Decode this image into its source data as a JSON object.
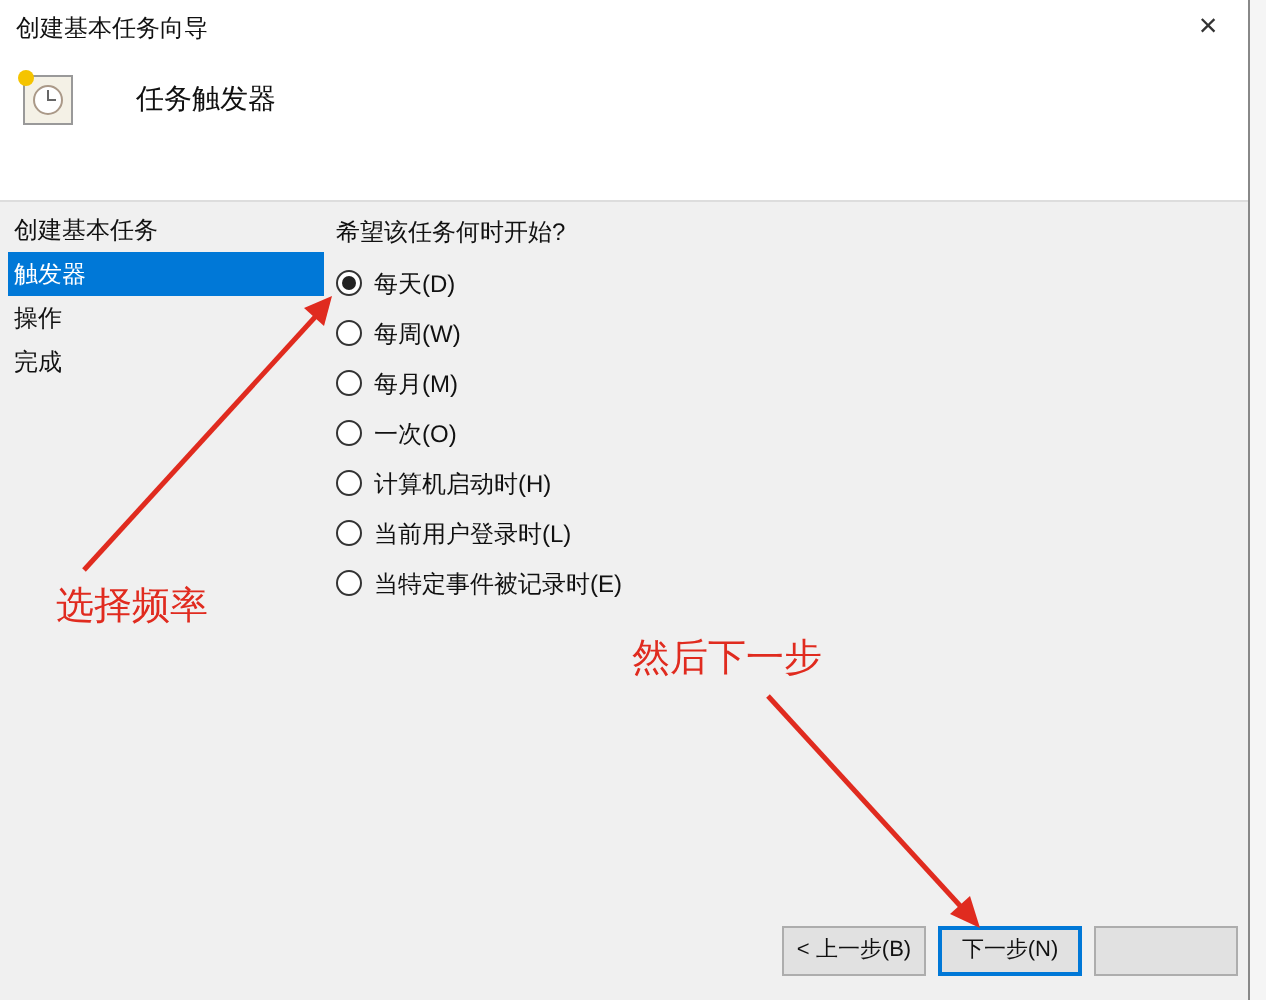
{
  "window": {
    "title": "创建基本任务向导",
    "close": "×"
  },
  "header": {
    "title": "任务触发器"
  },
  "sidebar": {
    "items": [
      {
        "label": "创建基本任务",
        "selected": false
      },
      {
        "label": "触发器",
        "selected": true
      },
      {
        "label": "操作",
        "selected": false
      },
      {
        "label": "完成",
        "selected": false
      }
    ]
  },
  "question": "希望该任务何时开始?",
  "options": [
    {
      "label": "每天(D)",
      "selected": true
    },
    {
      "label": "每周(W)",
      "selected": false
    },
    {
      "label": "每月(M)",
      "selected": false
    },
    {
      "label": "一次(O)",
      "selected": false
    },
    {
      "label": "计算机启动时(H)",
      "selected": false
    },
    {
      "label": "当前用户登录时(L)",
      "selected": false
    },
    {
      "label": "当特定事件被记录时(E)",
      "selected": false
    }
  ],
  "buttons": [
    {
      "label": "< 上一步(B)",
      "focused": false
    },
    {
      "label": "下一步(N)",
      "focused": true
    },
    {
      "focused": false
    }
  ],
  "annotations": [
    {
      "text": "选择频率"
    },
    {
      "text": "然后下一步"
    }
  ]
}
